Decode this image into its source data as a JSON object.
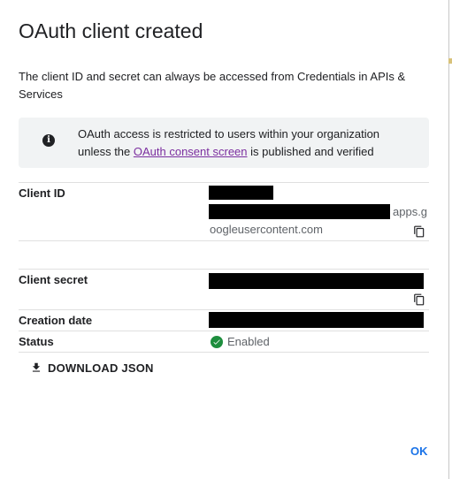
{
  "dialog": {
    "title": "OAuth client created",
    "description": "The client ID and secret can always be accessed from Credentials in APIs & Services"
  },
  "notice": {
    "icon": "info-icon",
    "text_before": "OAuth access is restricted to users within your organization unless the ",
    "link_text": "OAuth consent screen",
    "text_after": " is published and verified"
  },
  "fields": {
    "client_id": {
      "label": "Client ID",
      "suffix_part1": "apps.g",
      "suffix_part2": "oogleusercontent.com"
    },
    "client_secret": {
      "label": "Client secret"
    },
    "creation_date": {
      "label": "Creation date"
    },
    "status": {
      "label": "Status",
      "value": "Enabled",
      "icon": "check-circle-icon"
    }
  },
  "actions": {
    "download_label": "DOWNLOAD JSON",
    "ok_label": "OK"
  },
  "colors": {
    "link": "#7b2e9f",
    "accent": "#1a73e8",
    "enabled": "#1e8e3e"
  }
}
